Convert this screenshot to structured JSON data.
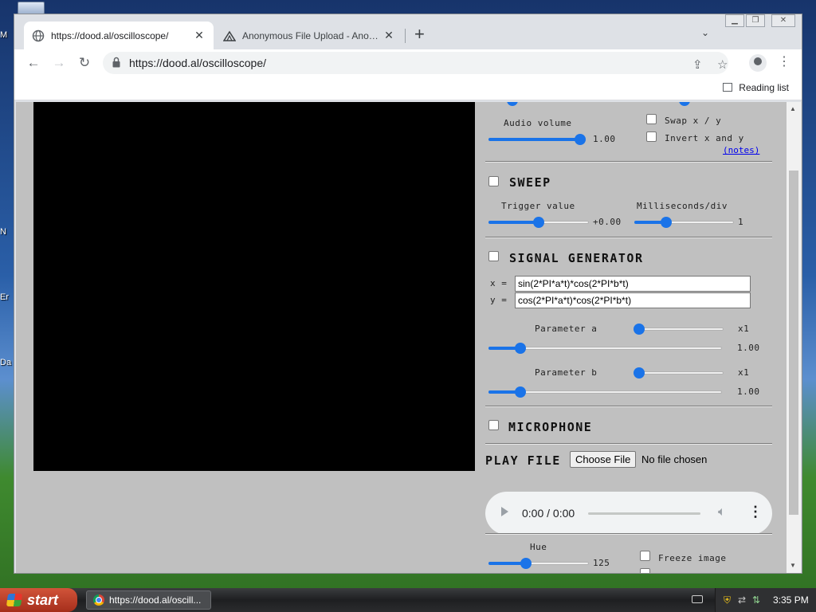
{
  "desktop": {
    "icons": [
      "M",
      "N",
      "Er",
      "Da"
    ]
  },
  "browser": {
    "tabs": [
      {
        "title": "https://dood.al/oscilloscope/",
        "icon": "globe-icon",
        "active": true
      },
      {
        "title": "Anonymous File Upload - AnonFiles",
        "icon": "anonfiles-icon",
        "active": false
      }
    ],
    "new_tab_label": "+",
    "url": "https://dood.al/oscilloscope/",
    "reading_list_label": "Reading list"
  },
  "controls": {
    "audio_volume": {
      "label": "Audio volume",
      "value": "1.00",
      "level": 1.0
    },
    "swap_xy": {
      "label": "Swap x / y",
      "checked": false
    },
    "invert_xy": {
      "label": "Invert x and y",
      "checked": false
    },
    "notes_link": "(notes)",
    "sweep": {
      "title": "SWEEP",
      "enabled": false,
      "trigger": {
        "label": "Trigger value",
        "value": "+0.00",
        "level": 0.5
      },
      "ms_div": {
        "label": "Milliseconds/div",
        "value": "1",
        "level": 0.3
      }
    },
    "signal_generator": {
      "title": "SIGNAL GENERATOR",
      "enabled": false,
      "x_label": "x =",
      "y_label": "y =",
      "x_expr": "sin(2*PI*a*t)*cos(2*PI*b*t)",
      "y_expr": "cos(2*PI*a*t)*cos(2*PI*b*t)",
      "param_a": {
        "label": "Parameter a",
        "multiplier": "x1",
        "value": "1.00",
        "mult_level": 0.0,
        "level": 0.12
      },
      "param_b": {
        "label": "Parameter b",
        "multiplier": "x1",
        "value": "1.00",
        "mult_level": 0.0,
        "level": 0.12
      }
    },
    "microphone": {
      "title": "MICROPHONE",
      "enabled": false
    },
    "play_file": {
      "title": "PLAY FILE",
      "choose_label": "Choose File",
      "no_file": "No file chosen",
      "player_time": "0:00 / 0:00"
    },
    "hue": {
      "label": "Hue",
      "value": "125",
      "level": 0.36
    },
    "freeze": {
      "label": "Freeze image",
      "checked": false
    }
  },
  "taskbar": {
    "start_label": "start",
    "task_item": "https://dood.al/oscill...",
    "clock": "3:35 PM"
  }
}
